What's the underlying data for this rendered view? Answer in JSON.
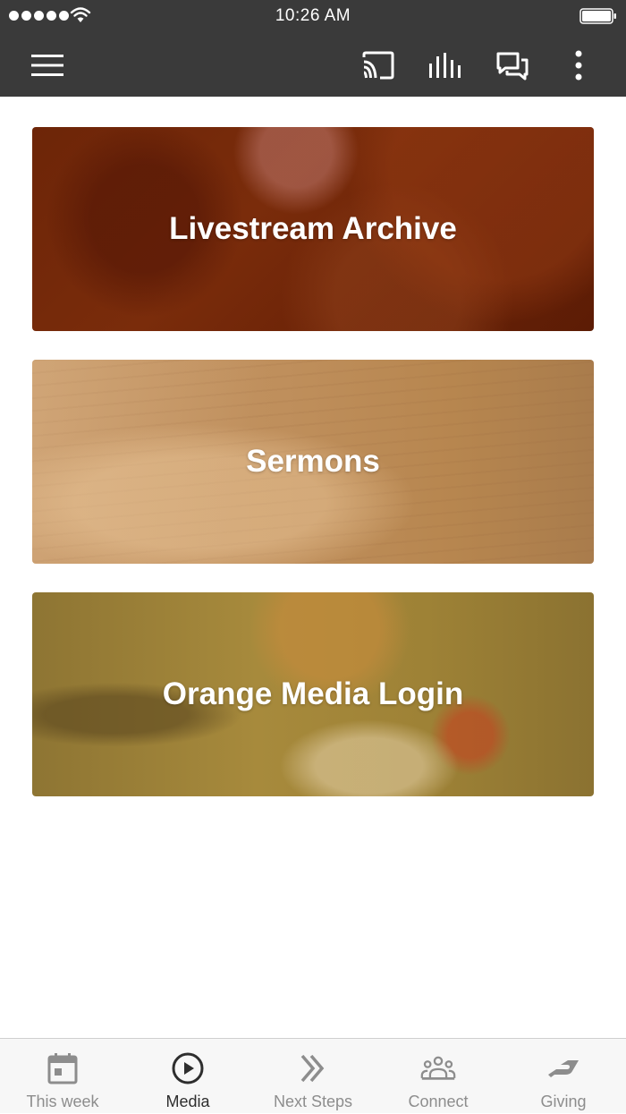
{
  "status_bar": {
    "time": "10:26 AM",
    "signal_icon": "signal-dots-icon",
    "wifi_icon": "wifi-icon",
    "battery_icon": "battery-icon"
  },
  "app_bar": {
    "background": "#3a3a3a",
    "icons": [
      "menu-icon",
      "cast-icon",
      "stats-bars-icon",
      "chat-icon",
      "more-vertical-icon"
    ]
  },
  "cards": [
    {
      "title": "Livestream Archive",
      "tint": "#6d2508"
    },
    {
      "title": "Sermons",
      "tint": "#bf8f5c"
    },
    {
      "title": "Orange Media Login",
      "tint": "#a78a3c"
    }
  ],
  "tabs": [
    {
      "label": "This week",
      "icon": "calendar-icon",
      "active": false
    },
    {
      "label": "Media",
      "icon": "play-circle-icon",
      "active": true
    },
    {
      "label": "Next Steps",
      "icon": "double-chevron-right-icon",
      "active": false
    },
    {
      "label": "Connect",
      "icon": "group-icon",
      "active": false
    },
    {
      "label": "Giving",
      "icon": "giving-hand-icon",
      "active": false
    }
  ],
  "colors": {
    "tab_active": "#2e2e2e",
    "tab_inactive": "#8d8d8d",
    "bar_background": "#3a3a3a"
  }
}
